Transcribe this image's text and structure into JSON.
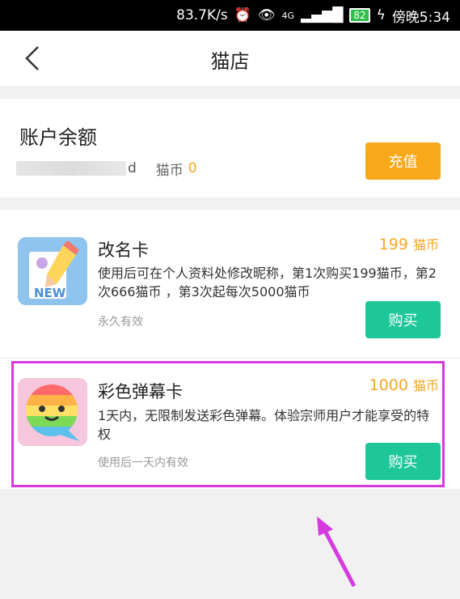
{
  "status_bar": {
    "speed": "83.7K/s",
    "network": "4G",
    "battery": "82",
    "time": "傍晚5:34"
  },
  "header": {
    "title": "猫店"
  },
  "balance": {
    "title": "账户余额",
    "account_suffix": "d",
    "coin_label": "猫币",
    "coin_value": "0",
    "recharge_label": "充值"
  },
  "items": [
    {
      "name": "改名卡",
      "price": "199",
      "price_unit": "猫币",
      "desc": "使用后可在个人资料处修改昵称，第1次购买199猫币，第2次666猫币 ，第3次起每次5000猫币",
      "note": "永久有效",
      "buy_label": "购买",
      "icon_text": "NEW"
    },
    {
      "name": "彩色弹幕卡",
      "price": "1000",
      "price_unit": "猫币",
      "desc": "1天内，无限制发送彩色弹幕。体验宗师用户才能享受的特权",
      "note": "使用后一天内有效",
      "buy_label": "购买"
    }
  ],
  "colors": {
    "accent_orange": "#f7a81b",
    "accent_green": "#1ec79a",
    "highlight": "#d63adf"
  }
}
